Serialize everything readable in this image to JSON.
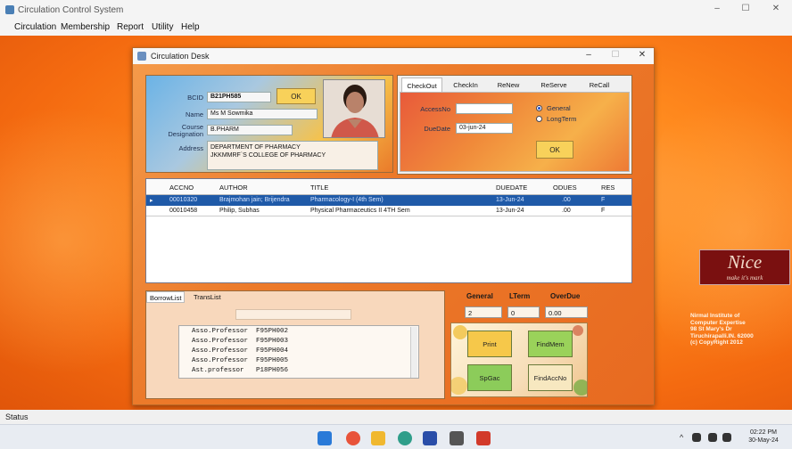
{
  "window": {
    "title": "Circulation Control System",
    "min": "–",
    "max": "☐",
    "close": "✕"
  },
  "menu": [
    "Circulation",
    "Membership",
    "Report",
    "Utility",
    "Help"
  ],
  "brand": {
    "logo": "Nice",
    "tagline": "make it's mark",
    "institute_lines": [
      "Nirmal Institute of",
      "Computer Expertise",
      "98 St Mary's Dr",
      "Tiruchirapalli.IN. 62000",
      "(c) CopyRight 2012"
    ]
  },
  "status": "Status",
  "dialog": {
    "title": "Circulation Desk",
    "member": {
      "bcid_label": "BCID",
      "bcid": "B21PH585",
      "ok": "OK",
      "name_label": "Name",
      "name": "Ms M Sowmika",
      "course_label": "Course",
      "designation_label": "Designation",
      "course": "B.PHARM",
      "address_label": "Address",
      "address": [
        "DEPARTMENT OF PHARMACY",
        "JKKMMRF`S COLLEGE OF PHARMACY"
      ]
    },
    "tabs": [
      "CheckOut",
      "CheckIn",
      "ReNew",
      "ReServe",
      "ReCall"
    ],
    "checkout": {
      "accessno_label": "AccessNo",
      "accessno": "",
      "duedate_label": "DueDate",
      "duedate": "03-jun-24",
      "general": "General",
      "longterm": "LongTerm",
      "ok": "OK"
    },
    "grid": {
      "columns": [
        "ACCNO",
        "AUTHOR",
        "TITLE",
        "DUEDATE",
        "ODUES",
        "RES"
      ],
      "rows": [
        {
          "accno": "00010320",
          "author": "Brajmohan jain; Brijendra",
          "title": "Pharmacology-I (4th Sem)",
          "duedate": "13-Jun-24",
          "odues": ".00",
          "res": "F"
        },
        {
          "accno": "00010458",
          "author": "Philip, Subhas",
          "title": "Physical Pharmaceutics II 4TH Sem",
          "duedate": "13-Jun-24",
          "odues": ".00",
          "res": "F"
        }
      ]
    },
    "borrow": {
      "tabs": [
        "BorrowList",
        "TransList"
      ],
      "items": [
        "Asso.Professor  F95PH002",
        "Asso.Professor  F95PH003",
        "Asso.Professor  F95PH004",
        "Asso.Professor  F95PH005",
        "Ast.professor   P18PH056"
      ]
    },
    "counts": {
      "general_label": "General",
      "lterm_label": "LTerm",
      "overdue_label": "OverDue",
      "general": "2",
      "lterm": "0",
      "overdue": "0.00"
    },
    "actions": {
      "print": "Print",
      "findmem": "FindMem",
      "spgac": "SpGac",
      "findaccno": "FindAccNo"
    }
  },
  "taskbar": {
    "tray": "^",
    "time": "02:22 PM",
    "date": "30-May-24"
  },
  "colors": {
    "desktop": "#f47a1a",
    "selected_row": "#1f5aa8",
    "ok_button": "#f8d15a"
  }
}
